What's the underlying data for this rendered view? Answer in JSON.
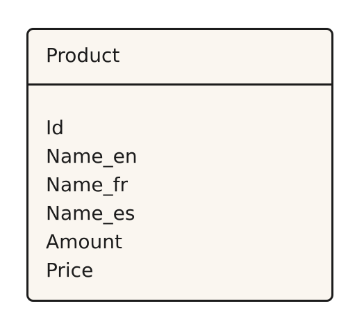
{
  "entity": {
    "title": "Product",
    "fields": [
      "Id",
      "Name_en",
      "Name_fr",
      "Name_es",
      "Amount",
      "Price"
    ]
  },
  "colors": {
    "border": "#1c1c1c",
    "fill": "#faf6f0",
    "text": "#1c1c1c",
    "background": "#ffffff"
  }
}
